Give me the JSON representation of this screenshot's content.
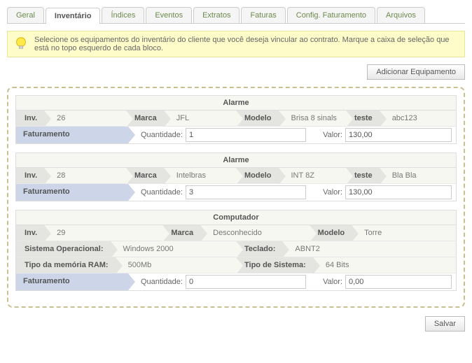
{
  "tabs": [
    "Geral",
    "Inventário",
    "Índices",
    "Eventos",
    "Extratos",
    "Faturas",
    "Config. Faturamento",
    "Arquivos"
  ],
  "activeTab": 1,
  "hint": "Selecione os equipamentos do inventário do cliente que você deseja vincular ao contrato. Marque a caixa de seleção que está no topo esquerdo de cada bloco.",
  "addBtn": "Adicionar Equipamento",
  "saveBtn": "Salvar",
  "labels": {
    "inv": "Inv.",
    "marca": "Marca",
    "modelo": "Modelo",
    "teste": "teste",
    "fat": "Faturamento",
    "qty": "Quantidade:",
    "valor": "Valor:",
    "so": "Sistema Operacional:",
    "teclado": "Teclado:",
    "ram": "Tipo da memória RAM:",
    "tiposis": "Tipo de Sistema:"
  },
  "blocks": [
    {
      "title": "Alarme",
      "rows": [
        [
          {
            "l": "inv",
            "v": "26"
          },
          {
            "l": "marca",
            "v": "JFL"
          },
          {
            "l": "modelo",
            "v": "Brisa 8 sinals"
          },
          {
            "l": "teste",
            "v": "abc123"
          }
        ]
      ],
      "fat": {
        "qty": "1",
        "valor": "130,00"
      }
    },
    {
      "title": "Alarme",
      "rows": [
        [
          {
            "l": "inv",
            "v": "28"
          },
          {
            "l": "marca",
            "v": "Intelbras"
          },
          {
            "l": "modelo",
            "v": "INT 8Z"
          },
          {
            "l": "teste",
            "v": "Bla Bla"
          }
        ]
      ],
      "fat": {
        "qty": "3",
        "valor": "130,00"
      }
    },
    {
      "title": "Computador",
      "rows": [
        [
          {
            "l": "inv",
            "v": "29"
          },
          {
            "l": "marca",
            "v": "Desconhecido"
          },
          {
            "l": "modelo",
            "v": "Torre"
          }
        ],
        [
          {
            "l": "so",
            "v": "Windows 2000"
          },
          {
            "l": "teclado",
            "v": "ABNT2"
          }
        ],
        [
          {
            "l": "ram",
            "v": "500Mb"
          },
          {
            "l": "tiposis",
            "v": "64 Bits"
          }
        ]
      ],
      "fat": {
        "qty": "0",
        "valor": "0,00"
      }
    }
  ]
}
